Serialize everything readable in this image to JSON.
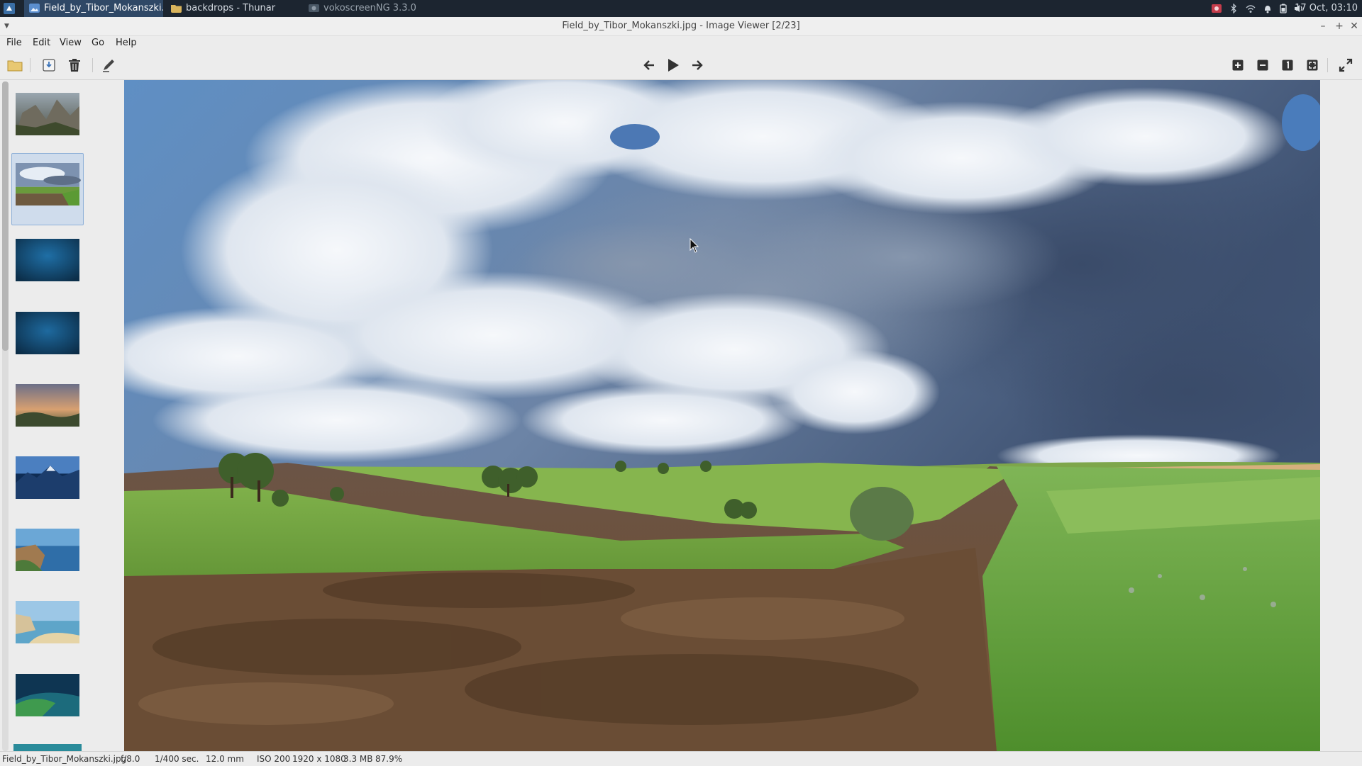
{
  "panel": {
    "tasks": [
      {
        "label": "Field_by_Tibor_Mokanszki.jp...",
        "icon": "image-viewer-icon",
        "active": true
      },
      {
        "label": "backdrops - Thunar",
        "icon": "folder-icon",
        "active": false
      },
      {
        "label": "vokoscreenNG 3.3.0",
        "icon": "screen-recorder-icon",
        "active": false
      }
    ],
    "tray_icons": [
      "recorder-tray-icon",
      "bluetooth-icon",
      "wifi-icon",
      "notification-bell-icon",
      "battery-icon",
      "volume-icon"
    ],
    "clock": "17 Oct, 03:10"
  },
  "window": {
    "title": "Field_by_Tibor_Mokanszki.jpg - Image Viewer [2/23]",
    "buttons": {
      "minimize": "–",
      "maximize": "+",
      "close": "✕"
    }
  },
  "menubar": {
    "file": "File",
    "edit": "Edit",
    "view": "View",
    "go": "Go",
    "help": "Help"
  },
  "toolbar": {
    "left": [
      "open-folder-icon",
      "save-copy-icon",
      "delete-icon",
      "edit-icon"
    ],
    "center": [
      "previous-icon",
      "play-slideshow-icon",
      "next-icon"
    ],
    "right": [
      "zoom-in-icon",
      "zoom-out-icon",
      "zoom-100-icon",
      "zoom-fit-icon",
      "fullscreen-icon"
    ]
  },
  "thumbnails": {
    "count_visible": 10,
    "selected_index": 1
  },
  "status": {
    "filename": "Field_by_Tibor_Mokanszki.jpg",
    "aperture": "f/8.0",
    "exposure": "1/400 sec.",
    "focal_length": "12.0 mm",
    "iso": "ISO 200",
    "dimensions": "1920 x 1080",
    "file_size": "3.3 MB",
    "zoom": "87.9%"
  },
  "colors": {
    "panel_bg": "#1c2530",
    "selection": "#cfdcec",
    "window_bg": "#ececec"
  }
}
